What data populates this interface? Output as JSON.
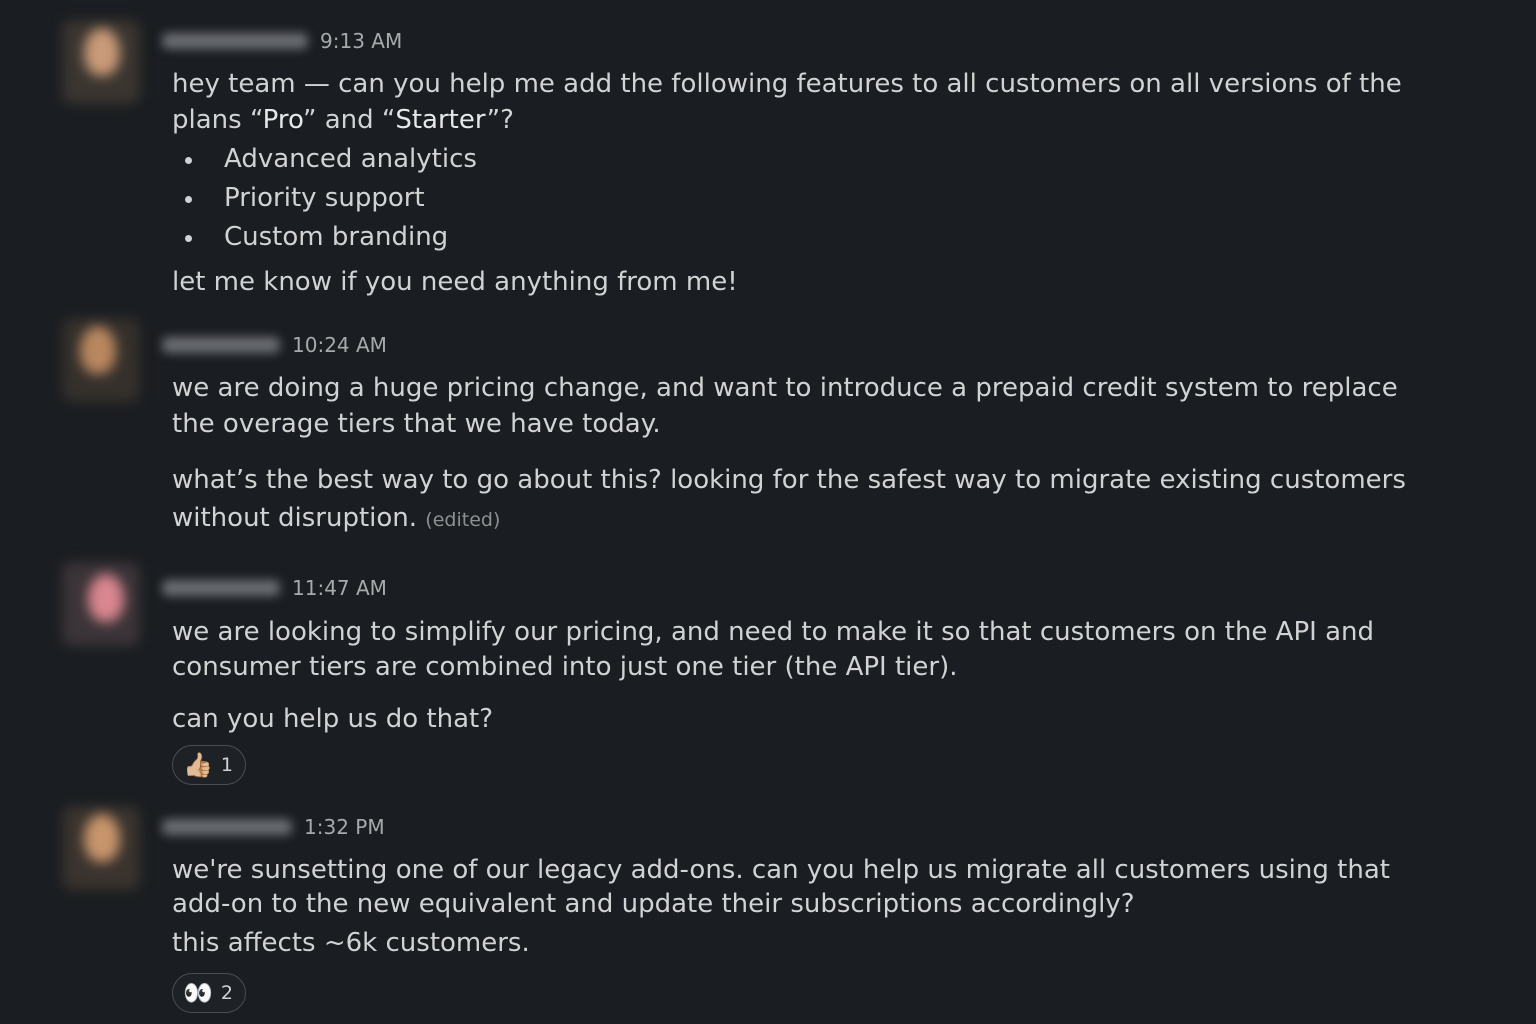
{
  "messages": [
    {
      "time": "9:13 AM",
      "intro_line1": "hey team — can you help me add the following features to all customers on all versions of the",
      "intro_line2_pre": "plans “",
      "plan_pro": "Pro",
      "intro_line2_mid": "” and “",
      "plan_starter": "Starter",
      "intro_line2_post": "”?",
      "bullets": [
        "Advanced analytics",
        "Priority support",
        "Custom branding"
      ],
      "outro": "let me know if you need anything from me!"
    },
    {
      "time": "10:24 AM",
      "line1": "we are doing a huge pricing change, and want to introduce a prepaid credit system to replace",
      "line2": "the overage tiers that we have today.",
      "line3": "what’s the best way to go about this? looking for the safest way to migrate existing customers",
      "line4": "without disruption.",
      "edited": "(edited)"
    },
    {
      "time": "11:47 AM",
      "line1": "we are looking to simplify our pricing, and need to make it so that customers on the API and",
      "line2": "consumer tiers are combined into just one tier (the API tier).",
      "line3": "can you help us do that?",
      "reaction": {
        "emoji": "👍🏼",
        "count": "1"
      }
    },
    {
      "time": "1:32 PM",
      "line1": "we're sunsetting one of our legacy add-ons. can you help us migrate all customers using that",
      "line2": "add-on to the new equivalent and update their subscriptions accordingly?",
      "line3": "this affects ~6k customers.",
      "reaction": {
        "emoji": "👀",
        "count": "2"
      }
    }
  ],
  "colors": {
    "background": "#1a1d21",
    "text": "#d1d2d3",
    "timestamp": "#a8a9ab"
  }
}
